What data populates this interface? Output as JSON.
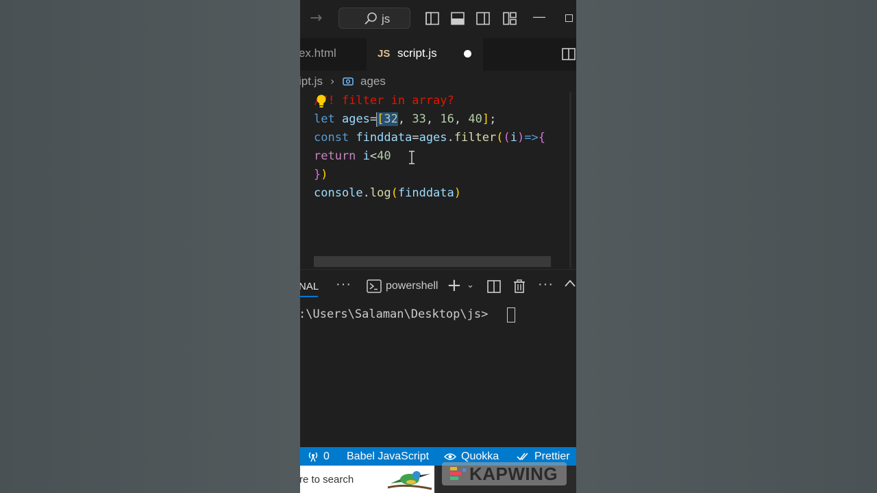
{
  "titlebar": {
    "search_text": "js"
  },
  "tabs": [
    {
      "label": "ex.html",
      "active": false
    },
    {
      "label": "script.js",
      "lang_badge": "JS",
      "active": true,
      "modified": true
    }
  ],
  "breadcrumb": {
    "file": "ipt.js",
    "symbol": "ages"
  },
  "editor": {
    "lines": [
      "//! filter in array?",
      "let ages=[32, 33, 16, 40];",
      "const finddata=ages.filter((i)=>{",
      "return i<40",
      "})",
      "console.log(finddata)"
    ],
    "tokens": {
      "l1_comment": "! filter in array?",
      "l2_let": "let",
      "l2_ages": "ages",
      "l2_eq": "=",
      "l2_open": "[",
      "l2_n1": "32",
      "l2_c1": ", ",
      "l2_n2": "33",
      "l2_c2": ", ",
      "l2_n3": "16",
      "l2_c3": ", ",
      "l2_n4": "40",
      "l2_close": "]",
      "l2_semi": ";",
      "l3_const": "const",
      "l3_var": "finddata",
      "l3_eq": "=",
      "l3_ages": "ages",
      "l3_dot": ".",
      "l3_filter": "filter",
      "l3_p1": "(",
      "l3_p2": "(",
      "l3_i": "i",
      "l3_p3": ")",
      "l3_arrow": "=>",
      "l3_brace": "{",
      "l4_return": "return",
      "l4_i": "i",
      "l4_lt": "<",
      "l4_num": "40",
      "l5_brace": "}",
      "l5_paren": ")",
      "l6_console": "console",
      "l6_dot": ".",
      "l6_log": "log",
      "l6_open": "(",
      "l6_arg": "finddata",
      "l6_close": ")"
    }
  },
  "panel": {
    "active_tab": "NAL",
    "terminal_name": "powershell",
    "prompt": ":\\Users\\Salaman\\Desktop\\js> "
  },
  "statusbar": {
    "remote_count": "0",
    "language": "Babel JavaScript",
    "quokka": "Quokka",
    "prettier": "Prettier"
  },
  "taskbar": {
    "search_placeholder": "re to search"
  },
  "watermark": {
    "text": "KAPWING"
  },
  "colors": {
    "status_bar": "#007acc",
    "accent": "#0078d4",
    "keyword": "#569cd6",
    "variable": "#9cdcfe",
    "function": "#dcdcaa",
    "number": "#b5cea8",
    "comment": "#e51400"
  }
}
